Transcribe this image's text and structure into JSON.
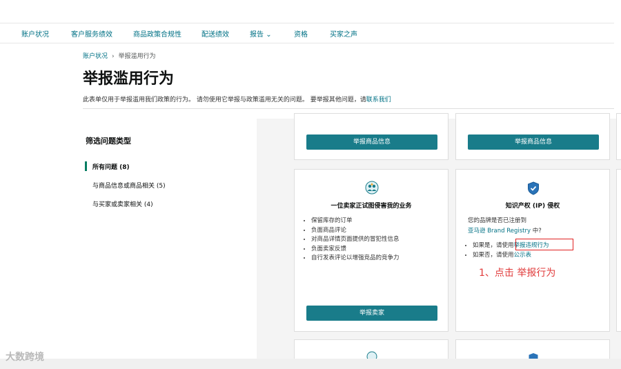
{
  "nav": {
    "items": [
      "账户状况",
      "客户服务绩效",
      "商品政策合规性",
      "配送绩效",
      "报告",
      "资格",
      "买家之声"
    ],
    "report_caret": "⌄"
  },
  "breadcrumb": {
    "parent": "账户状况",
    "separator": "›",
    "current": "举报滥用行为"
  },
  "page": {
    "title": "举报滥用行为",
    "description": "此表单仅用于举报滥用我们政策的行为。 请勿使用它举报与政策滥用无关的问题。 要举报其他问题，请",
    "contact_link": "联系我们"
  },
  "sidebar": {
    "title": "筛选问题类型",
    "items": [
      "所有问题 (8)",
      "与商品信息或商品相关 (5)",
      "与买家或卖家相关 (4)"
    ],
    "active_index": 0
  },
  "cards": {
    "top_left_button": "举报商品信息",
    "top_right_button": "举报商品信息",
    "seller": {
      "icon": "people-warning-icon",
      "title": "一位卖家正试图侵害我的业务",
      "bullets": [
        "保留库存的订单",
        "负面商品评论",
        "对商品详情页面提供的冒犯性信息",
        "负面卖家反馈",
        "自行发表评论以增强竞品的竞争力"
      ],
      "button": "举报卖家"
    },
    "ip": {
      "icon": "shield-check-icon",
      "title": "知识产权 (IP) 侵权",
      "question_line1": "您的品牌是否已注册到",
      "question_link": "亚马逊 Brand Registry",
      "question_suffix": " 中?",
      "yes_prefix": "如果是，请使用",
      "yes_link": "举报违规行为",
      "no_prefix": "如果否，请使用",
      "no_link": "公示表"
    }
  },
  "annotation": "1、点击 举报行为",
  "watermark": "大数跨境",
  "colors": {
    "accent": "#197c8a",
    "link": "#007185",
    "highlight": "#e02020",
    "active_bar": "#067d62"
  }
}
